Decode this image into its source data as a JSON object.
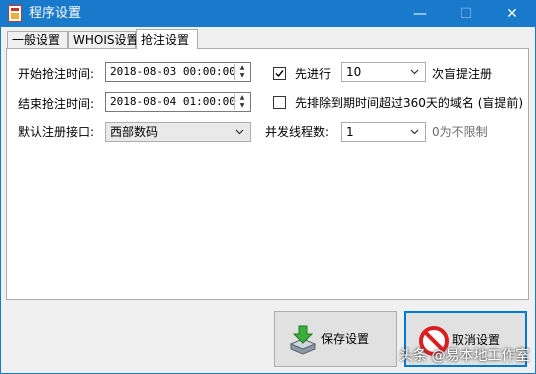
{
  "window": {
    "title": "程序设置",
    "minimize_glyph": "—",
    "maximize_glyph": "☐",
    "close_glyph": "✕"
  },
  "tabs": [
    {
      "label": "一般设置",
      "active": false
    },
    {
      "label": "WHOIS设置",
      "active": false
    },
    {
      "label": "抢注设置",
      "active": true
    }
  ],
  "form": {
    "start_time": {
      "label": "开始抢注时间:",
      "value": "2018-08-03 00:00:00"
    },
    "end_time": {
      "label": "结束抢注时间:",
      "value": "2018-08-04 01:00:00"
    },
    "interface": {
      "label": "默认注册接口:",
      "value": "西部数码"
    },
    "pre_check": {
      "checked": true,
      "label": "先进行",
      "value": "10",
      "suffix": "次盲提注册"
    },
    "exclude_expired": {
      "checked": false,
      "label": "先排除到期时间超过360天的域名 (盲提前)"
    },
    "threads": {
      "label": "并发线程数:",
      "value": "1",
      "hint": "0为不限制"
    }
  },
  "buttons": {
    "save_label": "保存设置",
    "cancel_label": "取消设置"
  },
  "watermark": "头条 @易本地工作室",
  "colors": {
    "titlebar": "#1979ca",
    "focus_border": "#0078d7"
  }
}
